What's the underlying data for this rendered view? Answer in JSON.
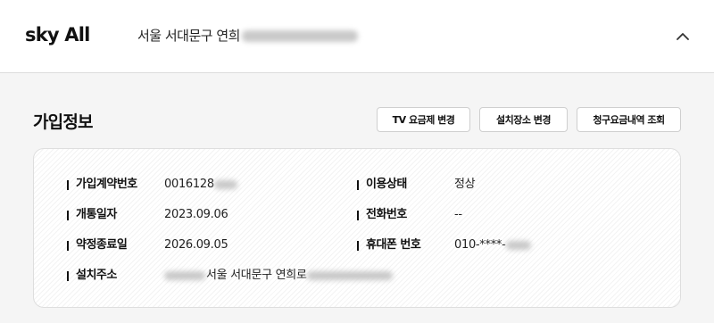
{
  "header": {
    "brand": "sky All",
    "address": "서울 서대문구 연희",
    "collapse_icon": "chevron-up-icon"
  },
  "section": {
    "title": "가입정보",
    "buttons": {
      "tv_plan_change": "TV 요금제 변경",
      "install_location_change": "설치장소 변경",
      "billing_history": "청구요금내역 조회"
    }
  },
  "info": {
    "contract_no": {
      "label": "가입계약번호",
      "value": "0016128"
    },
    "status": {
      "label": "이용상태",
      "value": "정상"
    },
    "open_date": {
      "label": "개통일자",
      "value": "2023.09.06"
    },
    "phone": {
      "label": "전화번호",
      "value": "--"
    },
    "contract_end": {
      "label": "약정종료일",
      "value": "2026.09.05"
    },
    "mobile": {
      "label": "휴대폰 번호",
      "value": "010-****-"
    },
    "install_address": {
      "label": "설치주소",
      "value": "서울 서대문구 연희로"
    }
  }
}
